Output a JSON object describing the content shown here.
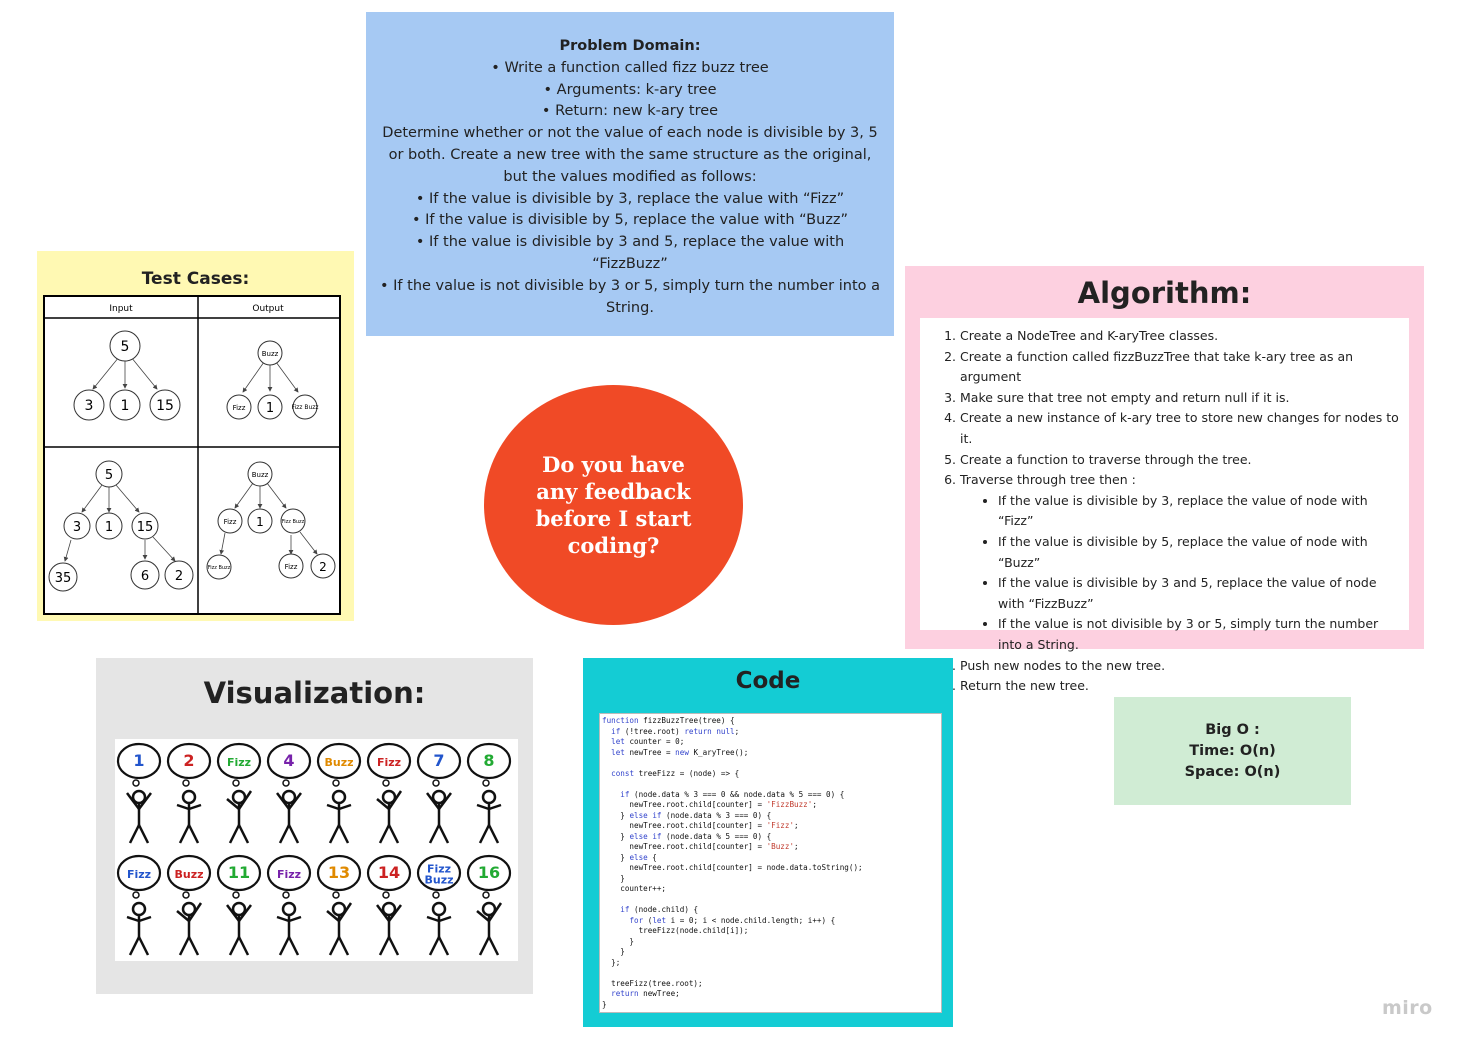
{
  "problem": {
    "title": "Problem Domain:",
    "bullets1": [
      "Write a function called fizz buzz tree",
      "Arguments: k-ary tree",
      "Return: new k-ary tree"
    ],
    "paragraph": "Determine whether or not the value of each node is divisible by 3, 5 or both. Create a new tree with the same structure as the original, but the values modified as follows:",
    "bullets2": [
      "If the value is divisible by 3, replace the value with “Fizz”",
      "If the value is divisible by 5, replace the value with “Buzz”",
      "If the value is divisible by 3 and 5, replace the value with “FizzBuzz”",
      "If the value is not divisible by 3 or 5, simply turn the number into a String."
    ]
  },
  "tests": {
    "title": "Test Cases:",
    "input_header": "Input",
    "output_header": "Output",
    "case1_input": {
      "root": "5",
      "children": [
        "3",
        "1",
        "15"
      ]
    },
    "case1_output": {
      "root": "Buzz",
      "children": [
        "Fizz",
        "1",
        "Fizz Buzz"
      ]
    },
    "case2_input": {
      "root": "5",
      "children": [
        "3",
        "1",
        "15"
      ],
      "grandchildren": [
        "35",
        "6",
        "2"
      ]
    },
    "case2_output": {
      "root": "Buzz",
      "children": [
        "Fizz",
        "1",
        "Fizz Buzz"
      ],
      "grandchildren": [
        "Fizz Buzz",
        "Fizz",
        "2"
      ]
    }
  },
  "feedback": {
    "text": "Do you have any feedback before I start coding?"
  },
  "algorithm": {
    "title": "Algorithm:",
    "steps": [
      "Create a NodeTree and K-aryTree classes.",
      "Create a function called fizzBuzzTree that take k-ary tree as an argument",
      "Make sure that tree not empty and return null if it is.",
      "Create a new instance of k-ary tree to store new changes for nodes to it.",
      "Create a function to traverse through the tree.",
      "Traverse through tree then :"
    ],
    "sub_steps": [
      "If the value is divisible by 3, replace the value of node with “Fizz”",
      "If the value is divisible by 5, replace the value of node with “Buzz”",
      "If the value is divisible by 3 and 5, replace the value of node with “FizzBuzz”",
      "If the value is not divisible by 3 or 5, simply turn the number into a String."
    ],
    "steps_after": [
      "Push new nodes to the new tree.",
      "Return the new tree."
    ]
  },
  "visualization": {
    "title": "Visualization:",
    "row1": [
      "1",
      "2",
      "Fizz",
      "4",
      "Buzz",
      "Fizz",
      "7",
      "8"
    ],
    "row2": [
      "Fizz",
      "Buzz",
      "11",
      "Fizz",
      "13",
      "14",
      "Fizz Buzz",
      "16"
    ],
    "colors": [
      "#2255cc",
      "#cc2222",
      "#22aa33",
      "#7722aa",
      "#e08a00",
      "#cc2222",
      "#2255cc",
      "#22aa33"
    ]
  },
  "code": {
    "title": "Code",
    "lines": [
      "function fizzBuzzTree(tree) {",
      "  if (!tree.root) return null;",
      "  let counter = 0;",
      "  let newTree = new K_aryTree();",
      "",
      "  const treeFizz = (node) => {",
      "",
      "    if (node.data % 3 === 0 && node.data % 5 === 0) {",
      "      newTree.root.child[counter] = 'FizzBuzz';",
      "    } else if (node.data % 3 === 0) {",
      "      newTree.root.child[counter] = 'Fizz';",
      "    } else if (node.data % 5 === 0) {",
      "      newTree.root.child[counter] = 'Buzz';",
      "    } else {",
      "      newTree.root.child[counter] = node.data.toString();",
      "    }",
      "    counter++;",
      "",
      "    if (node.child) {",
      "      for (let i = 0; i < node.child.length; i++) {",
      "        treeFizz(node.child[i]);",
      "      }",
      "    }",
      "  };",
      "",
      "  treeFizz(tree.root);",
      "  return newTree;",
      "}"
    ]
  },
  "bigo": {
    "title": "Big O :",
    "time": "Time: O(n)",
    "space": "Space: O(n)"
  },
  "brand": "miro",
  "colors": {
    "problem": "#a6c9f3",
    "tests": "#fff9b3",
    "feedback": "#f04a26",
    "algorithm": "#fdd0e0",
    "visualization": "#e5e5e5",
    "code": "#14ccd4",
    "bigo": "#d0ecd4"
  }
}
